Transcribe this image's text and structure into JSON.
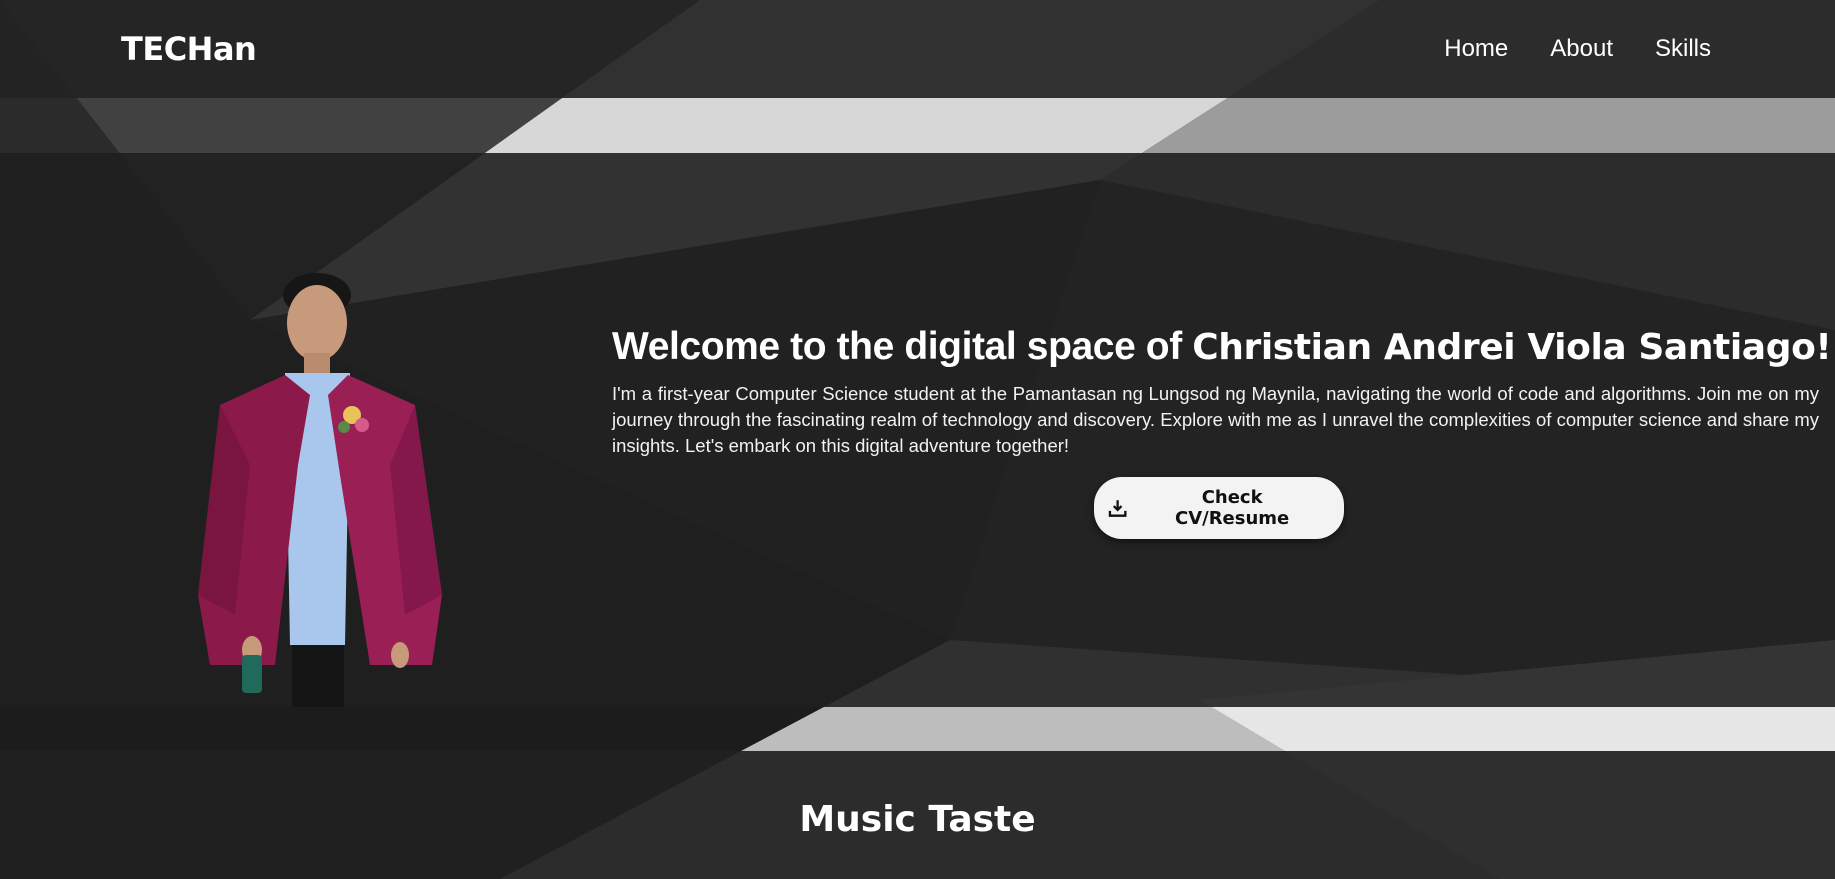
{
  "header": {
    "logo": "TECHan",
    "nav": [
      {
        "label": "Home"
      },
      {
        "label": "About"
      },
      {
        "label": "Skills"
      }
    ]
  },
  "hero": {
    "title_prefix": "Welcome to the digital space of ",
    "title_name": "Christian Andrei Viola Santiago!",
    "description": "I'm a first-year Computer Science student at the Pamantasan ng Lungsod ng Maynila, navigating the world of code and algorithms. Join me on my journey through the fascinating realm of technology and discovery. Explore with me as I unravel the complexities of computer science and share my insights. Let's embark on this digital adventure together!",
    "cta_label": "Check CV/Resume",
    "cta_icon": "download-icon",
    "portrait_icon": "portrait-image"
  },
  "music": {
    "title": "Music Taste"
  },
  "colors": {
    "background": "#1f1f1f",
    "button_bg": "#f3f3f3",
    "robe": "#8b1a4a",
    "shirt": "#a9c7ec"
  }
}
